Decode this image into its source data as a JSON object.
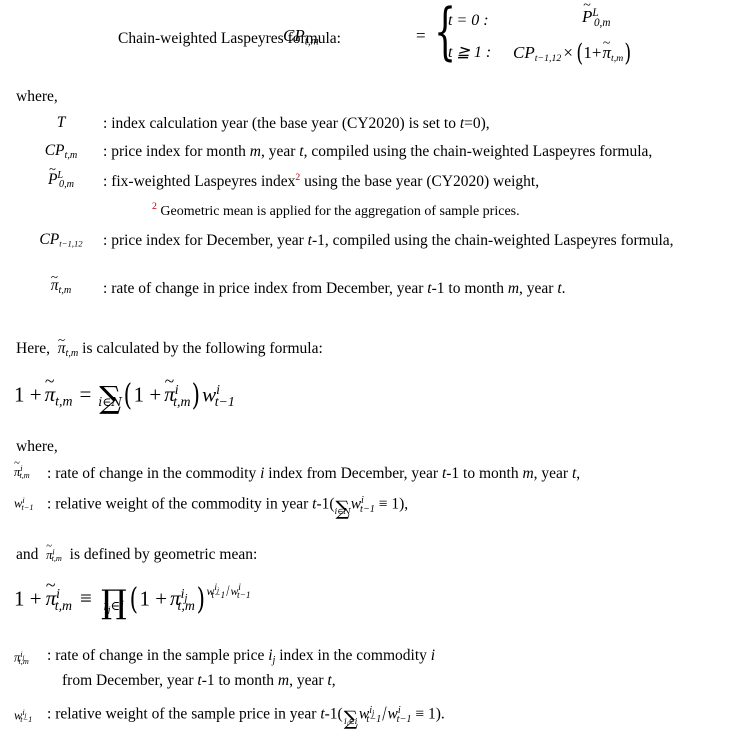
{
  "document": {
    "type": "academic-formula-page",
    "background_color": "#ffffff",
    "text_color": "#000000",
    "footnote_marker_color": "#c00000"
  },
  "formula_1": {
    "label": "Chain-weighted Laspeyres formula:",
    "lhs": "CP",
    "lhs_sub": "t,m",
    "equals": "=",
    "case_1_condition": "t = 0 :",
    "case_1_value_base": "P",
    "case_1_value_sup": "L",
    "case_1_value_sub": "0,m",
    "case_2_condition": "t ≧ 1 :",
    "case_2_value": "CP",
    "case_2_value_sub": "t−1,12",
    "case_2_times": "×",
    "case_2_paren": "(1 +",
    "case_2_pi": "π",
    "case_2_pi_sub": "t,m",
    "case_2_paren_close": ")"
  },
  "where_label_1": "where,",
  "definitions_1": [
    {
      "symbol_base": "T",
      "text": "index calculation year (the base year (CY2020) is set to t=0),",
      "colon": ":"
    },
    {
      "symbol_base": "CP",
      "symbol_sub": "t,m",
      "text": "price index for month m, year t, compiled using the chain-weighted Laspeyres formula,",
      "colon": ":"
    },
    {
      "symbol_base": "P",
      "symbol_sup": "L",
      "symbol_sub": "0,m",
      "text": "fix-weighted Laspeyres index² using the base year (CY2020) weight,",
      "colon": ":",
      "footnote_marker": "2"
    },
    {
      "symbol_base": "CP",
      "symbol_sub": "t−1,12",
      "text": "price index for December, year t-1, compiled using the chain-weighted Laspeyres formula,",
      "colon": ":"
    },
    {
      "symbol_base": "π",
      "symbol_sub": "t,m",
      "text": "rate of change in price index from December, year t-1 to month m, year t.",
      "colon": ":"
    }
  ],
  "footnote": {
    "marker": "2",
    "text": "Geometric mean is applied for the aggregation of sample prices."
  },
  "here_line": {
    "prefix": "Here,",
    "symbol_base": "π",
    "symbol_sub": "t,m",
    "suffix": "is calculated by the following formula:"
  },
  "formula_2": {
    "lhs": "1 +",
    "lhs_pi": "π",
    "lhs_pi_sub": "t,m",
    "equals": "=",
    "sum_symbol": "∑",
    "sum_limit": "i∈N",
    "paren_open": "(",
    "inner": "1 +",
    "inner_pi": "π",
    "inner_pi_sup": "i",
    "inner_pi_sub": "t,m",
    "paren_close": ")",
    "weight": "w",
    "weight_sup": "i",
    "weight_sub": "t−1"
  },
  "where_label_2": "where,",
  "definitions_2": [
    {
      "symbol_base": "π",
      "symbol_sup": "i",
      "symbol_sub": "t,m",
      "colon": ":",
      "text": "rate of change in the commodity i index from December, year t-1 to month m, year t,"
    },
    {
      "symbol_base": "w",
      "symbol_sup": "i",
      "symbol_sub": "t−1",
      "colon": ":",
      "text_before": "relative weight of the commodity in year t-1(",
      "sum_symbol": "∑",
      "sum_limit": "i∈N",
      "weight": "w",
      "weight_sup": "i",
      "weight_sub": "t−1",
      "identity": "≡ 1),"
    }
  ],
  "and_line": {
    "prefix": "and",
    "symbol_base": "π",
    "symbol_sup": "i",
    "symbol_sub": "t,m",
    "suffix": "is defined by geometric mean:"
  },
  "formula_3": {
    "lhs": "1 +",
    "lhs_pi": "π",
    "lhs_pi_sup": "i",
    "lhs_pi_sub": "t,m",
    "identity": "≡",
    "prod_symbol": "∏",
    "prod_limit": "i",
    "prod_limit_sub": "j",
    "prod_limit_rest": "∈i",
    "paren_open": "(",
    "inner": "1 +",
    "inner_pi": "π",
    "inner_pi_sup": "i",
    "inner_pi_sup_sub": "j",
    "inner_pi_sub": "t,m",
    "paren_close": ")",
    "exp_w": "w",
    "exp_w_sup": "i",
    "exp_w_sup_sub": "j",
    "exp_w_sub": "t−1",
    "exp_slash": "/",
    "exp_w2": "w",
    "exp_w2_sup": "i",
    "exp_w2_sub": "t−1"
  },
  "definitions_3": [
    {
      "symbol_base": "π",
      "symbol_sup": "i",
      "symbol_sup_sub": "j",
      "symbol_sub": "t,m",
      "colon": ":",
      "line_1": "rate of change in the sample price i_j index in the commodity i",
      "line_1_a": "rate of change in the sample price",
      "line_1_ij": "i",
      "line_1_ij_sub": "j",
      "line_1_b": "index in the commodity",
      "line_1_c": "i",
      "line_2_a": "from December, year",
      "line_2_t": "t",
      "line_2_b": "-1 to month",
      "line_2_m": "m",
      "line_2_c": ", year",
      "line_2_t2": "t",
      "line_2_d": ","
    },
    {
      "symbol_base": "w",
      "symbol_sup": "i",
      "symbol_sup_sub": "j",
      "symbol_sub": "t−1",
      "colon": ":",
      "text_before": "relative weight of the sample price in year t-1(",
      "sum_symbol": "∑",
      "sum_limit": "i",
      "sum_limit_sub": "j",
      "sum_limit_rest": "∈i",
      "weight": "w",
      "weight_sup": "i",
      "weight_sup_sub": "j",
      "weight_sub": "t−1",
      "slash": "/",
      "weight2": "w",
      "weight2_sup": "i",
      "weight2_sub": "t−1",
      "identity": "≡ 1)."
    }
  ]
}
